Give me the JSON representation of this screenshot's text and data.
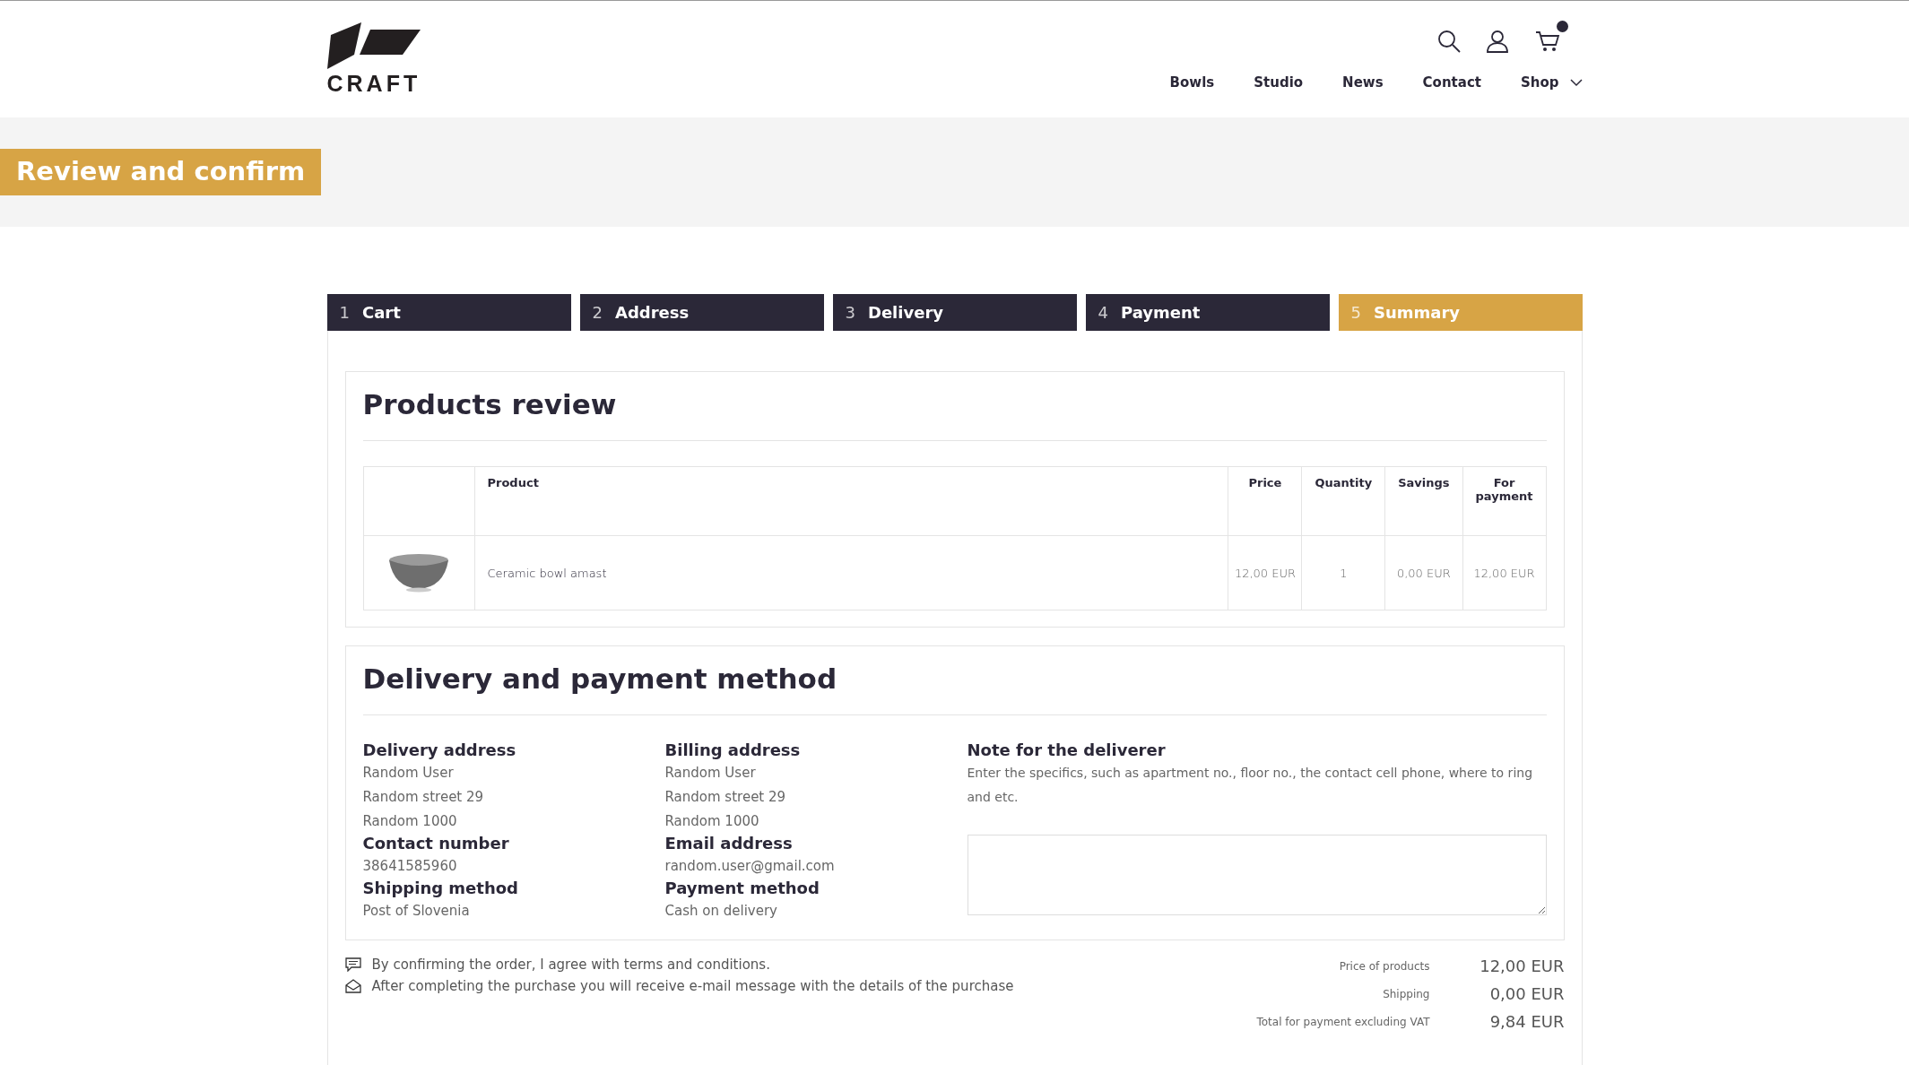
{
  "header": {
    "logo": "CRAFT",
    "cart_has_items": true,
    "nav": [
      {
        "label": "Bowls",
        "kind": "link"
      },
      {
        "label": "Studio",
        "kind": "link"
      },
      {
        "label": "News",
        "kind": "link"
      },
      {
        "label": "Contact",
        "kind": "link"
      },
      {
        "label": "Shop",
        "kind": "dropdown"
      }
    ]
  },
  "banner": {
    "title": "Review and confirm"
  },
  "steps": [
    {
      "number": "1",
      "label": "Cart",
      "selected": false
    },
    {
      "number": "2",
      "label": "Address",
      "selected": false
    },
    {
      "number": "3",
      "label": "Delivery",
      "selected": false
    },
    {
      "number": "4",
      "label": "Payment",
      "selected": false
    },
    {
      "number": "5",
      "label": "Summary",
      "selected": true
    }
  ],
  "products_review": {
    "title": "Products review",
    "columns": [
      "Product",
      "Price",
      "Quantity",
      "Savings",
      "For payment"
    ],
    "rows": [
      {
        "product": "Ceramic bowl amast",
        "price": "12,00 EUR",
        "quantity": "1",
        "savings": "0,00 EUR",
        "for_payment": "12,00 EUR"
      }
    ]
  },
  "delivery_payment": {
    "title": "Delivery and payment method",
    "columns": [
      [
        {
          "heading": "Delivery address",
          "lines": [
            "Random User",
            "Random street 29",
            "Random 1000"
          ]
        },
        {
          "heading": "Contact number",
          "lines": [
            "38641585960"
          ]
        },
        {
          "heading": "Shipping method",
          "lines": [
            "Post of Slovenia"
          ]
        }
      ],
      [
        {
          "heading": "Billing address",
          "lines": [
            "Random User",
            "Random street 29",
            "Random 1000"
          ]
        },
        {
          "heading": "Email address",
          "lines": [
            "random.user@gmail.com"
          ]
        },
        {
          "heading": "Payment method",
          "lines": [
            "Cash on delivery"
          ]
        }
      ]
    ],
    "note": {
      "heading": "Note for the deliverer",
      "text": "Enter the specifics, such as apartment no., floor no., the contact cell phone, where to ring and etc."
    }
  },
  "footer": {
    "notes": [
      {
        "kind": "terms",
        "text": "By confirming the order, I agree with terms and conditions."
      },
      {
        "kind": "email",
        "text": "After completing the purchase you will receive e-mail message with the details of the purchase"
      }
    ],
    "totals": [
      {
        "label": "Price of products",
        "value": "12,00 EUR"
      },
      {
        "label": "Shipping",
        "value": "0,00 EUR"
      },
      {
        "label": "Total for payment excluding VAT",
        "value": "9,84 EUR"
      }
    ]
  }
}
